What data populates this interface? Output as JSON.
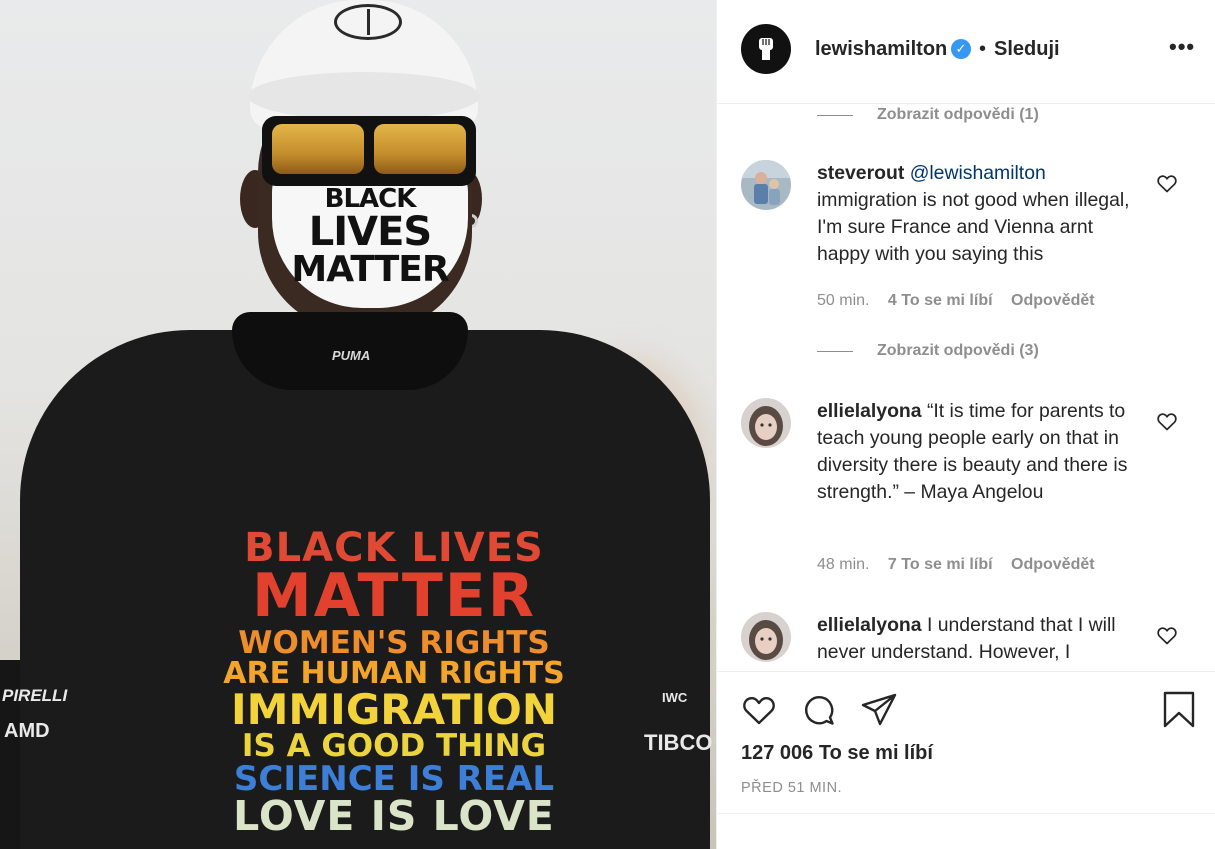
{
  "post_header": {
    "username": "lewishamilton",
    "verified_icon": "verified-badge-icon",
    "separator": "•",
    "follow_state": "Sleduji",
    "more_icon": "more-options-icon",
    "more_glyph": "•••"
  },
  "photo": {
    "mask_text": [
      "BLACK",
      "LIVES",
      "MATTER"
    ],
    "neck_brand": "PUMA",
    "shirt_lines": [
      "BLACK LIVES",
      "MATTER",
      "WOMEN'S RIGHTS",
      "ARE HUMAN RIGHTS",
      "IMMIGRATION",
      "IS A GOOD THING",
      "SCIENCE IS REAL",
      "LOVE IS LOVE"
    ],
    "sponsors": [
      "PIRELLI",
      "AMD",
      "TIBCO",
      "IWC"
    ],
    "colors": {
      "shirt_red": "#e2412e",
      "shirt_orange": "#ee8d2c",
      "shirt_yellow": "#f3d33a",
      "shirt_blue": "#3d7fd6",
      "shirt_mint": "#d9e4c8"
    }
  },
  "comments": {
    "replies_1": "Zobrazit odpovědi (1)",
    "replies_2": "Zobrazit odpovědi (3)",
    "items": [
      {
        "username": "steverout",
        "mention": "@lewishamilton",
        "text": "immigration is not good when illegal, I'm sure France and Vienna arnt happy with you saying this",
        "time": "50 min.",
        "likes": "4 To se mi líbí",
        "reply": "Odpovědět"
      },
      {
        "username": "ellielalyona",
        "text": "“It is time for parents to teach young people early on that in diversity there is beauty and there is strength.” – Maya Angelou",
        "time": "48 min.",
        "likes": "7 To se mi líbí",
        "reply": "Odpovědět"
      },
      {
        "username": "ellielalyona",
        "text": "I understand that I will never understand. However, I"
      }
    ]
  },
  "actions": {
    "like_icon": "heart-icon",
    "comment_icon": "comment-icon",
    "share_icon": "paper-plane-icon",
    "save_icon": "bookmark-icon",
    "likes_count": "127 006 To se mi líbí",
    "posted_time": "PŘED 51 MIN."
  },
  "colors": {
    "text": "#262626",
    "muted": "#8e8e8e",
    "mention": "#00376b",
    "verified": "#3897f0",
    "divider": "#efefef"
  }
}
